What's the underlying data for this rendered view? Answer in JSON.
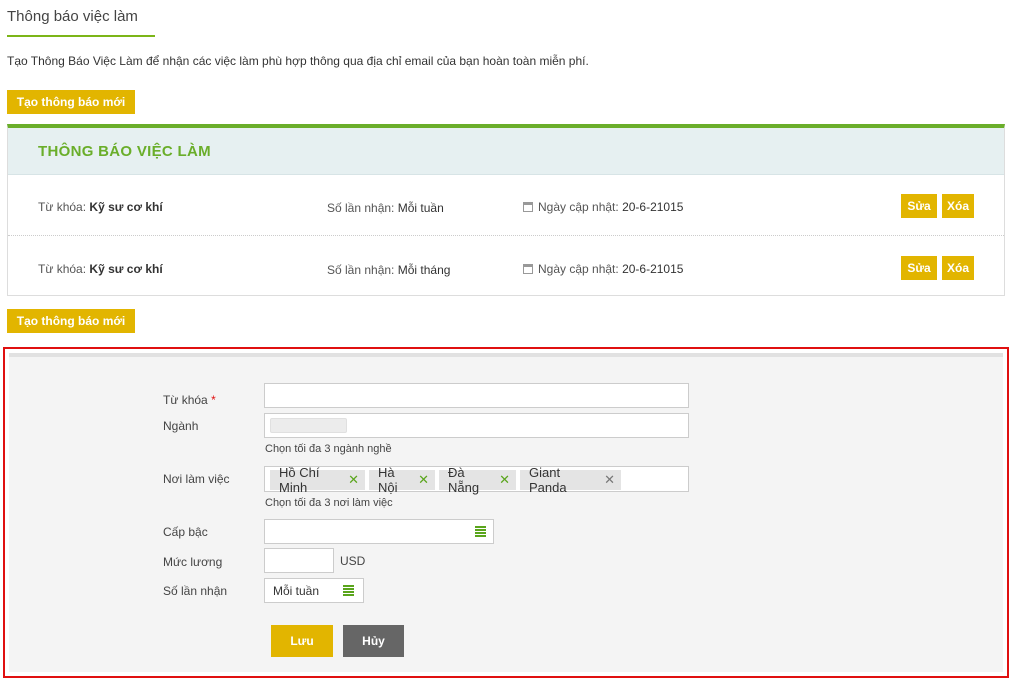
{
  "header": {
    "title": "Thông báo việc làm",
    "intro": "Tạo Thông Báo Việc Làm để nhận các việc làm phù hợp thông qua địa chỉ email của bạn hoàn toàn miễn phí.",
    "create_button": "Tạo thông báo mới"
  },
  "alerts": {
    "heading": "THÔNG BÁO VIỆC LÀM",
    "keyword_label": "Từ khóa:",
    "frequency_label": "Số lần nhận:",
    "date_label": "Ngày cập nhật:",
    "edit_label": "Sửa",
    "delete_label": "Xóa",
    "rows": [
      {
        "keyword": "Kỹ sư cơ khí",
        "frequency": "Mỗi tuần",
        "date": "20-6-21015"
      },
      {
        "keyword": "Kỹ sư cơ khí",
        "frequency": "Mỗi tháng",
        "date": "20-6-21015"
      }
    ]
  },
  "footer": {
    "create_button": "Tạo thông báo mới"
  },
  "form": {
    "keyword_label": "Từ khóa",
    "required_mark": "*",
    "keyword_value": "",
    "industry_label": "Ngành",
    "industry_hint": "Chọn tối đa 3 ngành nghề",
    "location_label": "Nơi làm việc",
    "location_tags": [
      "Hồ Chí Minh",
      "Hà Nội",
      "Đà Nẵng",
      "Giant Panda"
    ],
    "location_hint": "Chọn tối đa 3 nơi làm việc",
    "level_label": "Cấp bậc",
    "level_value": "",
    "salary_label": "Mức lương",
    "salary_value": "",
    "currency": "USD",
    "frequency_label": "Số lần nhận",
    "frequency_value": "Mỗi tuần",
    "save_button": "Lưu",
    "cancel_button": "Hủy"
  },
  "colors": {
    "accent_green": "#6aae2a",
    "button_yellow": "#e2b500",
    "highlight_red": "#e01010"
  }
}
